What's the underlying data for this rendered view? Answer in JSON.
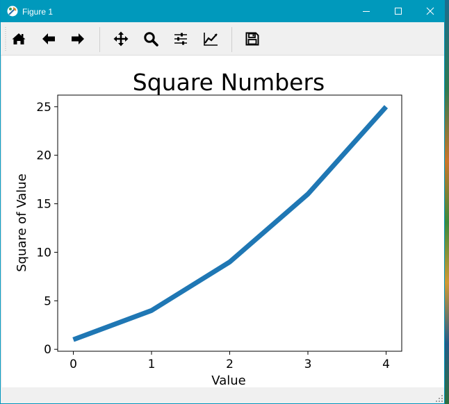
{
  "window": {
    "title": "Figure 1",
    "title_bar_color": "#0099bc",
    "controls": [
      "minimize-icon",
      "maximize-icon",
      "close-icon"
    ]
  },
  "toolbar": {
    "buttons": [
      {
        "name": "home",
        "icon": "home-icon"
      },
      {
        "name": "back",
        "icon": "arrow-left-icon"
      },
      {
        "name": "forward",
        "icon": "arrow-right-icon"
      },
      {
        "name": "pan",
        "icon": "move-arrows-icon"
      },
      {
        "name": "zoom",
        "icon": "magnifier-icon"
      },
      {
        "name": "subplots",
        "icon": "sliders-icon"
      },
      {
        "name": "edit-axis",
        "icon": "line-chart-icon"
      },
      {
        "name": "save",
        "icon": "floppy-disk-icon"
      }
    ]
  },
  "status": {
    "text": ""
  },
  "chart_data": {
    "type": "line",
    "title": "Square Numbers",
    "xlabel": "Value",
    "ylabel": "Square of Value",
    "x": [
      0,
      1,
      2,
      3,
      4
    ],
    "series": [
      {
        "values": [
          1,
          4,
          9,
          16,
          25
        ],
        "color": "#1f77b4"
      }
    ],
    "xlim": [
      -0.2,
      4.2
    ],
    "ylim": [
      -0.2,
      26.2
    ],
    "xticks": [
      "0",
      "1",
      "2",
      "3",
      "4"
    ],
    "yticks": [
      "0",
      "5",
      "10",
      "15",
      "20",
      "25"
    ],
    "grid": false,
    "legend": "none"
  }
}
